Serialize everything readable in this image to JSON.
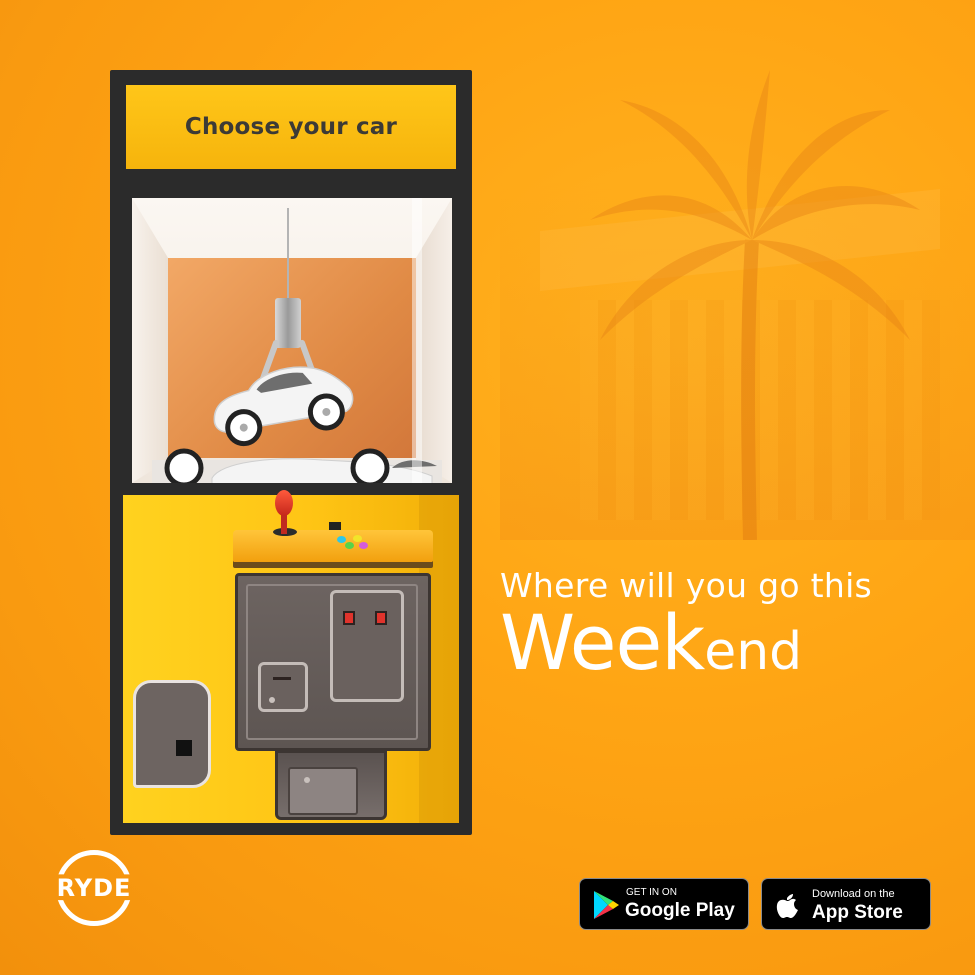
{
  "machine": {
    "sign_label": "Choose your car"
  },
  "headline": {
    "line1": "Where will you go this",
    "line2_big": "Week",
    "line2_small": "end"
  },
  "brand": {
    "logo_text": "RYDE"
  },
  "badges": {
    "google": {
      "small": "GET IN ON",
      "big": "Google Play"
    },
    "apple": {
      "small": "Download on the",
      "big": "App Store"
    }
  },
  "colors": {
    "background": "#ffa514",
    "machine_yellow": "#ffc515",
    "frame": "#2b2b2b",
    "text_light": "#ffffff"
  }
}
